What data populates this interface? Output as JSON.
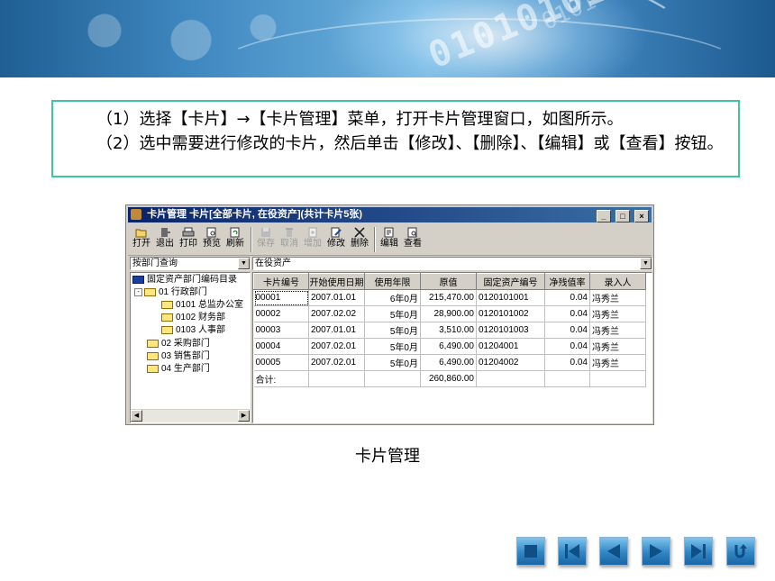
{
  "instructions": {
    "line1": "（1）选择【卡片】→【卡片管理】菜单，打开卡片管理窗口，如图所示。",
    "line2": "（2）选中需要进行修改的卡片，然后单击【修改】、【删除】、【编辑】或【查看】按钮。"
  },
  "window": {
    "title": "卡片管理  卡片[全部卡片, 在役资产](共计卡片5张)",
    "controls": [
      "_",
      "□",
      "×"
    ]
  },
  "toolbar": {
    "open": "打开",
    "exit": "退出",
    "print": "打印",
    "preview": "预览",
    "refresh": "刷新",
    "save": "保存",
    "cancel": "取消",
    "add": "增加",
    "modify": "修改",
    "delete": "删除",
    "edit": "编辑",
    "view": "查看"
  },
  "filters": {
    "query_mode": "按部门查询",
    "asset_status": "在役资产"
  },
  "tree": {
    "root": "固定资产部门编码目录",
    "nodes": [
      "01 行政部门",
      "0101 总监办公室",
      "0102 财务部",
      "0103 人事部",
      "02 采购部门",
      "03 销售部门",
      "04 生产部门"
    ]
  },
  "grid": {
    "columns": [
      "卡片编号",
      "开始使用日期",
      "使用年限",
      "原值",
      "固定资产编号",
      "净残值率",
      "录入人"
    ],
    "rows": [
      [
        "00001",
        "2007.01.01",
        "6年0月",
        "215,470.00",
        "0120101001",
        "0.04",
        "冯秀兰"
      ],
      [
        "00002",
        "2007.02.02",
        "5年0月",
        "28,900.00",
        "0120101002",
        "0.04",
        "冯秀兰"
      ],
      [
        "00003",
        "2007.01.01",
        "5年0月",
        "3,510.00",
        "0120101003",
        "0.04",
        "冯秀兰"
      ],
      [
        "00004",
        "2007.02.01",
        "5年0月",
        "6,490.00",
        "01204001",
        "0.04",
        "冯秀兰"
      ],
      [
        "00005",
        "2007.02.01",
        "5年0月",
        "6,490.00",
        "01204002",
        "0.04",
        "冯秀兰"
      ]
    ],
    "total_label": "合计:",
    "total_value": "260,860.00"
  },
  "caption": "卡片管理",
  "nav_icons": [
    "stop-icon",
    "first-icon",
    "prev-icon",
    "next-icon",
    "last-icon",
    "return-icon"
  ]
}
